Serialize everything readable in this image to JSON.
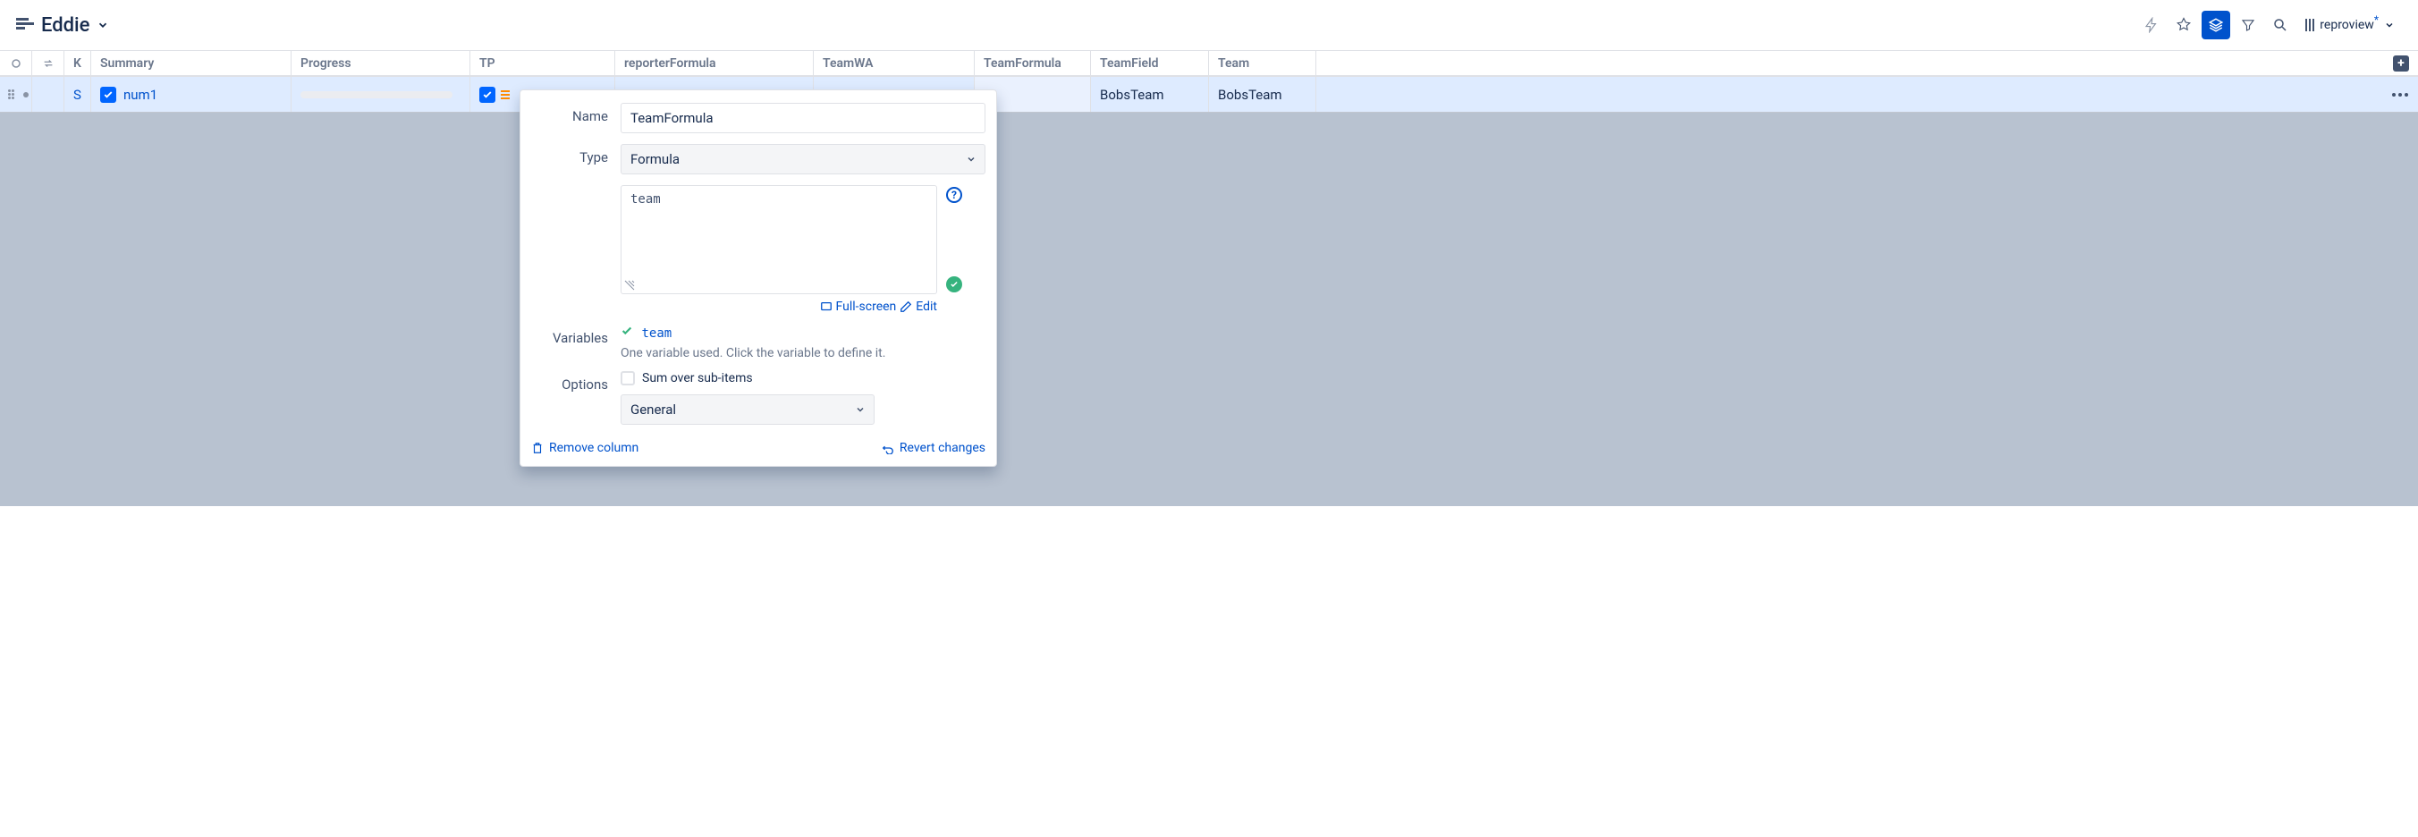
{
  "header": {
    "title": "Eddie",
    "view_name": "reproview",
    "view_modified": "*"
  },
  "columns": {
    "key": "K",
    "summary": "Summary",
    "progress": "Progress",
    "tp": "TP",
    "reporterFormula": "reporterFormula",
    "teamWA": "TeamWA",
    "teamFormula": "TeamFormula",
    "teamField": "TeamField",
    "team": "Team"
  },
  "row": {
    "key": "S",
    "summary": "num1",
    "teamField": "BobsTeam",
    "team": "BobsTeam"
  },
  "panel": {
    "labels": {
      "name": "Name",
      "type": "Type",
      "variables": "Variables",
      "options": "Options"
    },
    "name_value": "TeamFormula",
    "type_value": "Formula",
    "formula_value": "team",
    "fullscreen": "Full-screen",
    "edit": "Edit",
    "variable_tag": "team",
    "variable_hint": "One variable used. Click the variable to define it.",
    "sum_label": "Sum over sub-items",
    "general_value": "General",
    "remove": "Remove column",
    "revert": "Revert changes"
  }
}
